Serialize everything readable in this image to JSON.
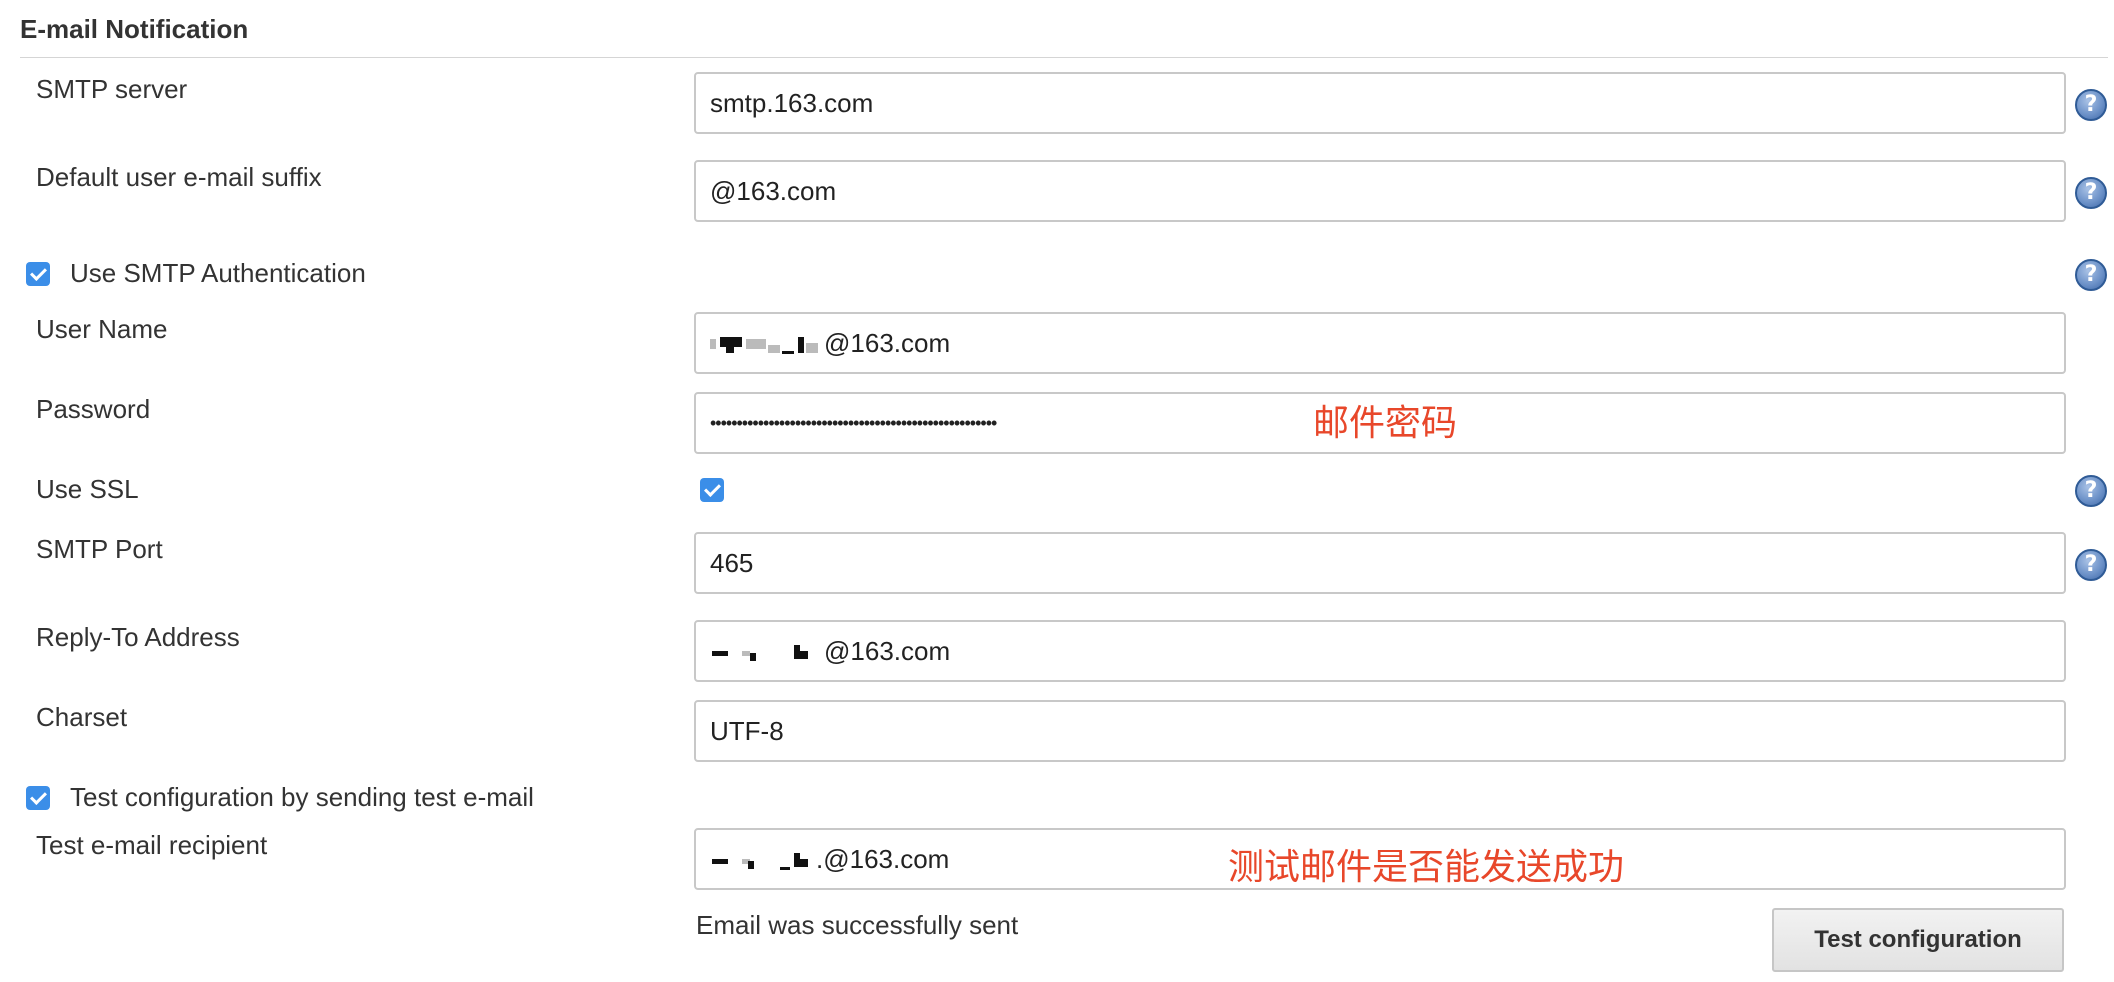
{
  "section": {
    "title": "E-mail Notification"
  },
  "fields": {
    "smtp_server": {
      "label": "SMTP server",
      "value": "smtp.163.com"
    },
    "default_suffix": {
      "label": "Default user e-mail suffix",
      "value": "@163.com"
    },
    "use_smtp_auth": {
      "label": "Use SMTP Authentication",
      "checked": true
    },
    "user_name": {
      "label": "User Name",
      "value_visible_suffix": "@163.com",
      "value_masked": true
    },
    "password": {
      "label": "Password",
      "value_masked": "••••••••••••••••••••••••••••••••••••••••••••••••••••••",
      "annotation": "邮件密码"
    },
    "use_ssl": {
      "label": "Use SSL",
      "checked": true
    },
    "smtp_port": {
      "label": "SMTP Port",
      "value": "465"
    },
    "reply_to": {
      "label": "Reply-To Address",
      "value_visible_suffix": "@163.com",
      "value_masked": true
    },
    "charset": {
      "label": "Charset",
      "value": "UTF-8"
    },
    "test_config": {
      "label": "Test configuration by sending test e-mail",
      "checked": true
    },
    "test_recipient": {
      "label": "Test e-mail recipient",
      "value_visible_suffix": ".@163.com",
      "value_masked": true,
      "annotation": "测试邮件是否能发送成功"
    }
  },
  "status": {
    "message": "Email was successfully sent"
  },
  "buttons": {
    "test_configuration": "Test configuration"
  },
  "icons": {
    "help": "help-icon",
    "help_glyph": "?",
    "checkbox": "checkbox-checked-icon"
  },
  "colors": {
    "checkbox": "#3b8ee8",
    "annotation": "#e8472a",
    "help": "#3d67a7"
  }
}
